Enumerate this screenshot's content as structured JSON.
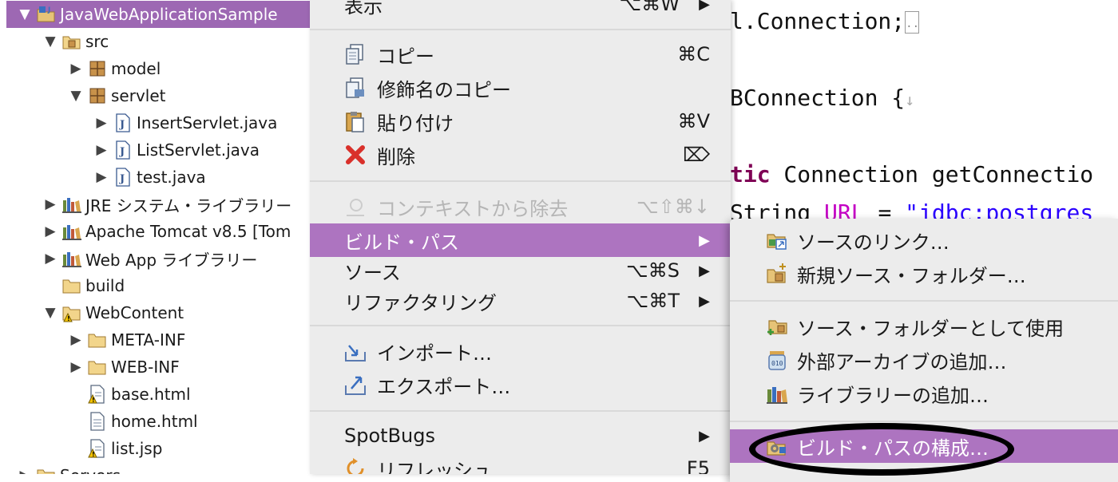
{
  "explorer": {
    "items": [
      {
        "label": "JavaWebApplicationSample",
        "twisty": "▼",
        "icon": "project-icon"
      },
      {
        "label": "src",
        "twisty": "▼",
        "icon": "source-folder-icon"
      },
      {
        "label": "model",
        "twisty": "▶",
        "icon": "package-icon"
      },
      {
        "label": "servlet",
        "twisty": "▼",
        "icon": "package-icon"
      },
      {
        "label": "InsertServlet.java",
        "twisty": "▶",
        "icon": "java-file-icon"
      },
      {
        "label": "ListServlet.java",
        "twisty": "▶",
        "icon": "java-file-icon"
      },
      {
        "label": "test.java",
        "twisty": "▶",
        "icon": "java-file-icon"
      },
      {
        "label": "JRE システム・ライブラリー",
        "twisty": "▶",
        "icon": "library-icon"
      },
      {
        "label": "Apache Tomcat v8.5 [Tom",
        "twisty": "▶",
        "icon": "library-icon"
      },
      {
        "label": "Web App ライブラリー",
        "twisty": "▶",
        "icon": "library-icon"
      },
      {
        "label": "build",
        "twisty": "",
        "icon": "folder-icon"
      },
      {
        "label": "WebContent",
        "twisty": "▼",
        "icon": "folder-warning-icon"
      },
      {
        "label": "META-INF",
        "twisty": "▶",
        "icon": "folder-icon"
      },
      {
        "label": "WEB-INF",
        "twisty": "▶",
        "icon": "folder-icon"
      },
      {
        "label": "base.html",
        "twisty": "",
        "icon": "file-warning-icon"
      },
      {
        "label": "home.html",
        "twisty": "",
        "icon": "file-icon"
      },
      {
        "label": "list.jsp",
        "twisty": "",
        "icon": "file-warning-icon"
      },
      {
        "label": "Servers",
        "twisty": "▶",
        "icon": "folder-icon"
      }
    ]
  },
  "editor": {
    "line1": "l.Connection;",
    "line1_ws": "..",
    "line2": "BConnection {",
    "line2_ws": "↓",
    "line3_kw": "tic",
    "line3_rest": " Connection getConnectio",
    "line4_a": "String ",
    "line4_url": "URL",
    "line4_b": " = ",
    "line4_str": "\"jdbc:postgres"
  },
  "context_menu": {
    "show": {
      "label": "表示",
      "shortcut": "⌥⌘W"
    },
    "copy": {
      "label": "コピー",
      "shortcut": "⌘C",
      "icon": "copy-icon"
    },
    "copy_qualified": {
      "label": "修飾名のコピー",
      "icon": "copy-qualified-icon"
    },
    "paste": {
      "label": "貼り付け",
      "shortcut": "⌘V",
      "icon": "paste-icon"
    },
    "delete": {
      "label": "削除",
      "shortcut": "⌦",
      "icon": "delete-icon"
    },
    "remove_context": {
      "label": "コンテキストから除去",
      "shortcut": "⌥⇧⌘↓",
      "icon": "remove-context-icon"
    },
    "build_path": {
      "label": "ビルド・パス"
    },
    "source": {
      "label": "ソース",
      "shortcut": "⌥⌘S"
    },
    "refactoring": {
      "label": "リファクタリング",
      "shortcut": "⌥⌘T"
    },
    "import": {
      "label": "インポート…",
      "icon": "import-icon"
    },
    "export": {
      "label": "エクスポート…",
      "icon": "export-icon"
    },
    "spotbugs": {
      "label": "SpotBugs"
    },
    "refresh": {
      "label": "リフレッシュ",
      "shortcut": "F5",
      "icon": "refresh-icon"
    },
    "arrow": "▶"
  },
  "submenu": {
    "link_source": {
      "label": "ソースのリンク…",
      "icon": "link-source-icon"
    },
    "new_source_folder": {
      "label": "新規ソース・フォルダー…",
      "icon": "new-source-folder-icon"
    },
    "use_as_source_folder": {
      "label": "ソース・フォルダーとして使用",
      "icon": "use-source-folder-icon"
    },
    "add_external_archives": {
      "label": "外部アーカイブの追加…",
      "icon": "jar-icon"
    },
    "add_libraries": {
      "label": "ライブラリーの追加…",
      "icon": "library-icon"
    },
    "configure_build_path": {
      "label": "ビルド・パスの構成…",
      "icon": "configure-build-path-icon"
    }
  },
  "colors": {
    "selection": "#9d68b3",
    "menu_highlight": "#ad74c0",
    "menu_bg": "#ececec",
    "keyword": "#7f0055",
    "string": "#2a00ff"
  }
}
